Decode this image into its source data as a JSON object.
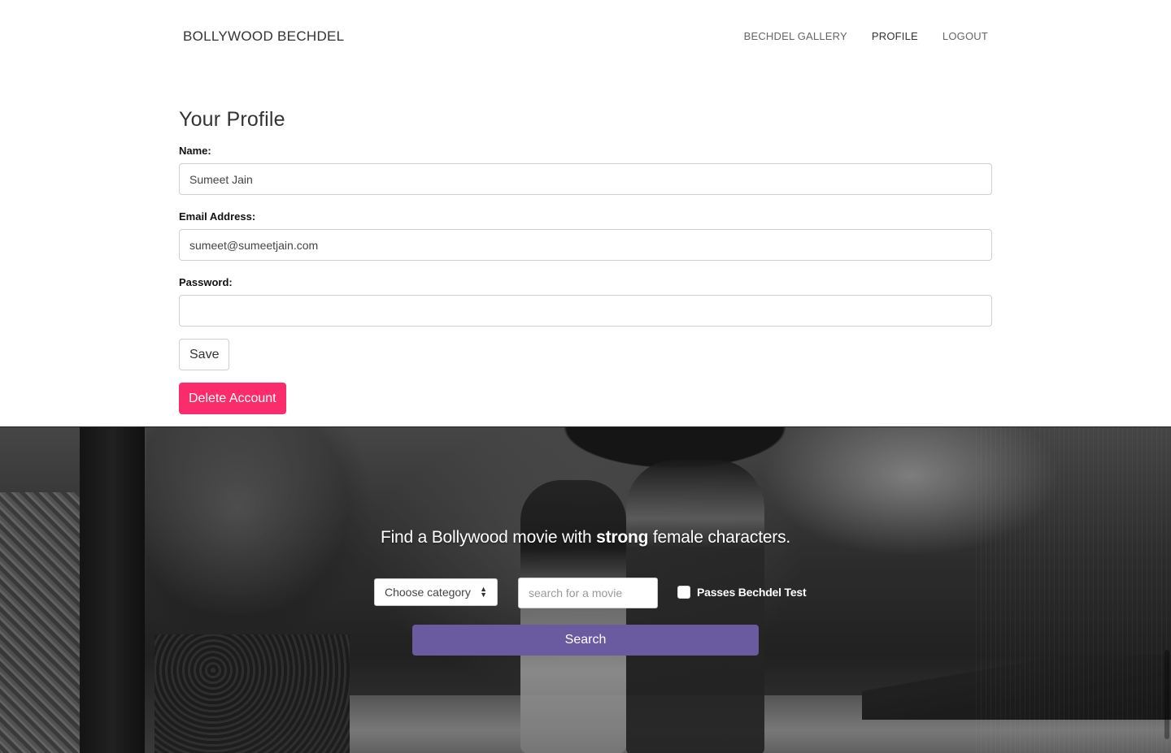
{
  "navbar": {
    "brand": "BOLLYWOOD BECHDEL",
    "links": [
      {
        "label": "BECHDEL GALLERY",
        "active": false
      },
      {
        "label": "PROFILE",
        "active": true
      },
      {
        "label": "LOGOUT",
        "active": false
      }
    ]
  },
  "profile": {
    "title": "Your Profile",
    "name_label": "Name:",
    "name_value": "Sumeet Jain",
    "email_label": "Email Address:",
    "email_value": "sumeet@sumeetjain.com",
    "password_label": "Password:",
    "password_value": "",
    "save_label": "Save",
    "delete_label": "Delete Account"
  },
  "hero": {
    "tagline_before": "Find a Bollywood movie with ",
    "tagline_strong": "strong",
    "tagline_after": " female characters.",
    "category_selected": "Choose category",
    "search_placeholder": "search for a movie",
    "search_value": "",
    "bechdel_checkbox_label": "Passes Bechdel Test",
    "bechdel_checked": false,
    "search_button": "Search"
  },
  "colors": {
    "delete_button": "#fb2c6c",
    "search_button": "#6a5aa0"
  },
  "icons": {
    "select_arrows": "up-down-caret-icon"
  }
}
